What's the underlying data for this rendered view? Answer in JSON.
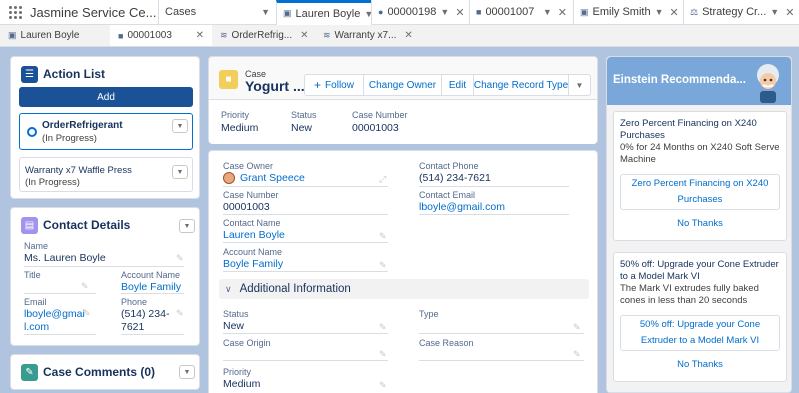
{
  "navbar": {
    "app_name": "Jasmine Service Ce...",
    "tabs": [
      {
        "label": "Cases",
        "icon": "none"
      },
      {
        "label": "Lauren Boyle",
        "icon": "contact-card-icon"
      },
      {
        "label": "00000198",
        "icon": "chat-icon"
      },
      {
        "label": "00001007",
        "icon": "case-icon"
      },
      {
        "label": "Emily Smith",
        "icon": "contact-card-icon"
      },
      {
        "label": "Strategy Cr...",
        "icon": "strategy-icon"
      }
    ]
  },
  "subtabs": [
    {
      "label": "Lauren Boyle"
    },
    {
      "label": "00001003"
    },
    {
      "label": "OrderRefrig..."
    },
    {
      "label": "Warranty x7..."
    }
  ],
  "action_list": {
    "title": "Action List",
    "add_label": "Add",
    "items": [
      {
        "name": "OrderRefrigerant",
        "status": "(In Progress)"
      },
      {
        "name": "Warranty x7 Waffle Press",
        "status": "(In Progress)"
      }
    ]
  },
  "contact_details": {
    "title": "Contact Details",
    "name_label": "Name",
    "name_value": "Ms. Lauren Boyle",
    "title_label": "Title",
    "account_label": "Account Name",
    "account_value": "Boyle Family",
    "email_label": "Email",
    "email_value_1": "lboyle@gmai",
    "email_value_2": "l.com",
    "phone_label": "Phone",
    "phone_value_1": "(514) 234-",
    "phone_value_2": "7621"
  },
  "case_comments": {
    "title": "Case Comments (0)"
  },
  "case_header": {
    "object_label": "Case",
    "record_name": "Yogurt ...",
    "follow_label": "Follow",
    "change_owner_label": "Change Owner",
    "edit_label": "Edit",
    "change_record_type_label": "Change Record Type",
    "priority_label": "Priority",
    "priority_value": "Medium",
    "status_label": "Status",
    "status_value": "New",
    "case_number_label": "Case Number",
    "case_number_value": "00001003"
  },
  "case_detail": {
    "case_owner_label": "Case Owner",
    "case_owner_value": "Grant Speece",
    "contact_phone_label": "Contact Phone",
    "contact_phone_value": "(514) 234-7621",
    "case_number_label": "Case Number",
    "case_number_value": "00001003",
    "contact_email_label": "Contact Email",
    "contact_email_value": "lboyle@gmail.com",
    "contact_name_label": "Contact Name",
    "contact_name_value": "Lauren Boyle",
    "account_name_label": "Account Name",
    "account_name_value": "Boyle Family",
    "additional_info_label": "Additional Information",
    "status_label": "Status",
    "status_value": "New",
    "type_label": "Type",
    "case_origin_label": "Case Origin",
    "case_reason_label": "Case Reason",
    "priority_label": "Priority",
    "priority_value": "Medium"
  },
  "einstein": {
    "title": "Einstein Recommenda...",
    "rec1": {
      "title": "Zero Percent Financing on X240 Purchases",
      "description": "0% for 24 Months on X240 Soft Serve Machine",
      "accept_label": "Zero Percent Financing on X240 Purchases",
      "reject_label": "No Thanks"
    },
    "rec2": {
      "title": "50% off: Upgrade your Cone Extruder to a Model Mark VI",
      "description": "The Mark VI extrudes fully baked cones in less than 20 seconds",
      "accept_label": "50% off: Upgrade your Cone Extruder to a Model Mark VI",
      "reject_label": "No Thanks"
    }
  },
  "colors": {
    "brand_blue": "#0070d2",
    "dark_blue_button": "#1b5297",
    "link_blue": "#006dcc",
    "background": "#b0c4df"
  }
}
